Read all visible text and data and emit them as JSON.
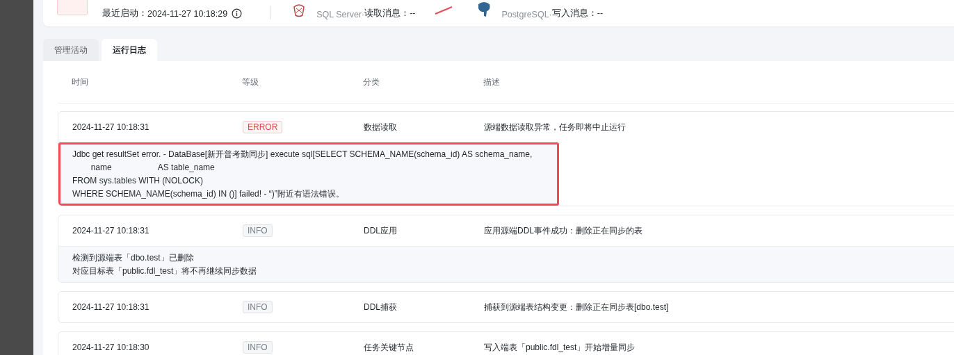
{
  "summary": {
    "status_badge": true,
    "last_start_label": "最近启动：",
    "last_start": "2024-11-27 10:18:29",
    "source": {
      "db": "SQL Server·",
      "message": "读取消息：--"
    },
    "target": {
      "db": "PostgreSQL·",
      "message": "写入消息：--"
    }
  },
  "tabs": [
    {
      "label": "管理活动",
      "selected": false
    },
    {
      "label": "运行日志",
      "selected": true
    }
  ],
  "log": {
    "columns": [
      "时间",
      "等级",
      "分类",
      "描述"
    ],
    "rows": [
      {
        "time": "2024-11-27 10:18:31",
        "severity": "ERROR",
        "category": "数据读取",
        "description": "源端数据读取异常，任务即将中止运行",
        "highlighted": true,
        "detail": [
          "Jdbc get resultSet error. - DataBase[新开普考勤同步] execute sql[SELECT SCHEMA_NAME(schema_id) AS schema_name,",
          "        name                    AS table_name",
          "FROM sys.tables WITH (NOLOCK)",
          "WHERE SCHEMA_NAME(schema_id) IN ()] failed! - “)”附近有语法错误。"
        ]
      },
      {
        "time": "2024-11-27 10:18:31",
        "severity": "INFO",
        "category": "DDL应用",
        "description": "应用源端DDL事件成功：删除正在同步的表",
        "highlighted": false,
        "detail": [
          "检测到源端表「dbo.test」已删除",
          "对应目标表「public.fdl_test」将不再继续同步数据"
        ]
      },
      {
        "time": "2024-11-27 10:18:31",
        "severity": "INFO",
        "category": "DDL捕获",
        "description": "捕获到源端表结构变更：删除正在同步表[dbo.test]",
        "highlighted": false,
        "detail": []
      },
      {
        "time": "2024-11-27 10:18:30",
        "severity": "INFO",
        "category": "任务关键节点",
        "description": "写入端表「public.fdl_test」开始增量同步",
        "highlighted": false,
        "detail": []
      }
    ]
  }
}
